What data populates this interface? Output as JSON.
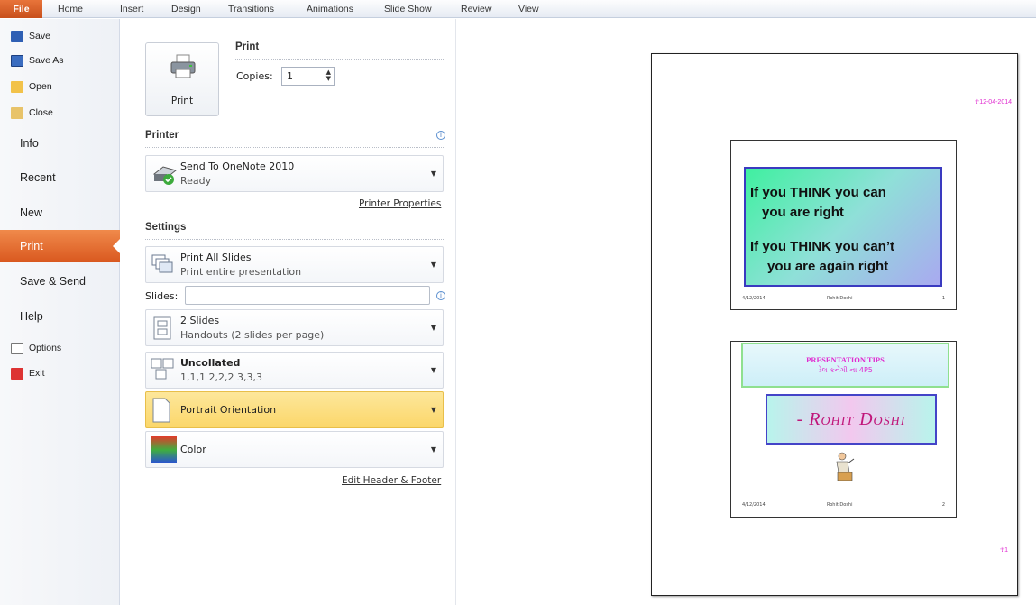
{
  "ribbon": {
    "tabs": [
      "File",
      "Home",
      "Insert",
      "Design",
      "Transitions",
      "Animations",
      "Slide Show",
      "Review",
      "View"
    ]
  },
  "backstage_nav": {
    "small_items": [
      "Save",
      "Save As",
      "Open",
      "Close"
    ],
    "big_items": [
      "Info",
      "Recent",
      "New",
      "Print",
      "Save & Send",
      "Help"
    ],
    "bottom_items": [
      "Options",
      "Exit"
    ],
    "active": "Print"
  },
  "print": {
    "title": "Print",
    "button_label": "Print",
    "copies_label": "Copies:",
    "copies_value": "1"
  },
  "printer": {
    "title": "Printer",
    "name": "Send To OneNote 2010",
    "status": "Ready",
    "properties_link": "Printer Properties"
  },
  "settings": {
    "title": "Settings",
    "range": {
      "label": "Print All Slides",
      "sub": "Print entire presentation"
    },
    "slides_label": "Slides:",
    "slides_value": "",
    "layout": {
      "label": "2 Slides",
      "sub": "Handouts (2 slides per page)"
    },
    "collation": {
      "label": "Uncollated",
      "sub": "1,1,1   2,2,2   3,3,3"
    },
    "orientation": {
      "label": "Portrait Orientation"
    },
    "color": {
      "label": "Color"
    },
    "header_footer_link": "Edit Header & Footer"
  },
  "preview": {
    "date": "☥12-04-2014",
    "page_number": "☥1",
    "slide1": {
      "line1": "If you THINK you can",
      "line2": "you are right",
      "line3": "If you THINK you can’t",
      "line4": "you are again right",
      "footer_left": "4/12/2014",
      "footer_center": "Rohit Doshi",
      "footer_right": "1"
    },
    "slide2": {
      "tips_title": "PRESENTATION TIPS",
      "tips_sub": "ડેલ કનેંગી ના 4P5",
      "name": "- Rohit  Doshi",
      "footer_left": "4/12/2014",
      "footer_center": "Rohit Doshi",
      "footer_right": "2"
    }
  },
  "colors": {
    "file_tab": "#d4602a",
    "active_nav": "#e46c2f",
    "highlight": "#fbd96f",
    "pink_text": "#e02bd0"
  }
}
